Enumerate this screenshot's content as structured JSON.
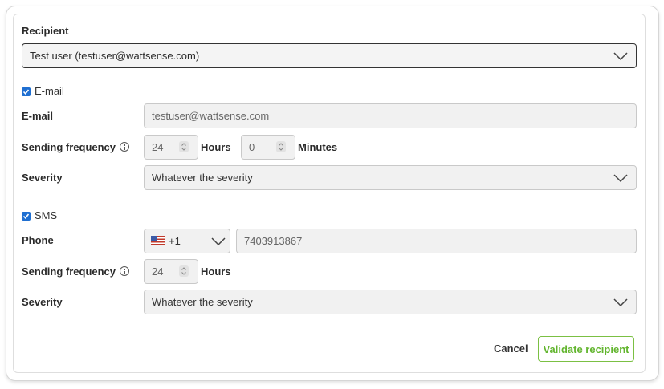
{
  "recipient": {
    "label": "Recipient",
    "selected": "Test user (testuser@wattsense.com)"
  },
  "email_section": {
    "checkbox_label": "E-mail",
    "checked": true,
    "email_label": "E-mail",
    "email_value": "testuser@wattsense.com",
    "frequency_label": "Sending frequency",
    "hours_value": "24",
    "hours_unit": "Hours",
    "minutes_value": "0",
    "minutes_unit": "Minutes",
    "severity_label": "Severity",
    "severity_value": "Whatever the severity"
  },
  "sms_section": {
    "checkbox_label": "SMS",
    "checked": true,
    "phone_label": "Phone",
    "country_code": "+1",
    "country_flag": "us-flag-icon",
    "phone_value": "7403913867",
    "frequency_label": "Sending frequency",
    "hours_value": "24",
    "hours_unit": "Hours",
    "severity_label": "Severity",
    "severity_value": "Whatever the severity"
  },
  "actions": {
    "cancel_label": "Cancel",
    "validate_label": "Validate recipient"
  },
  "colors": {
    "accent_green": "#62b52e",
    "checkbox_blue": "#1f6fd1"
  }
}
